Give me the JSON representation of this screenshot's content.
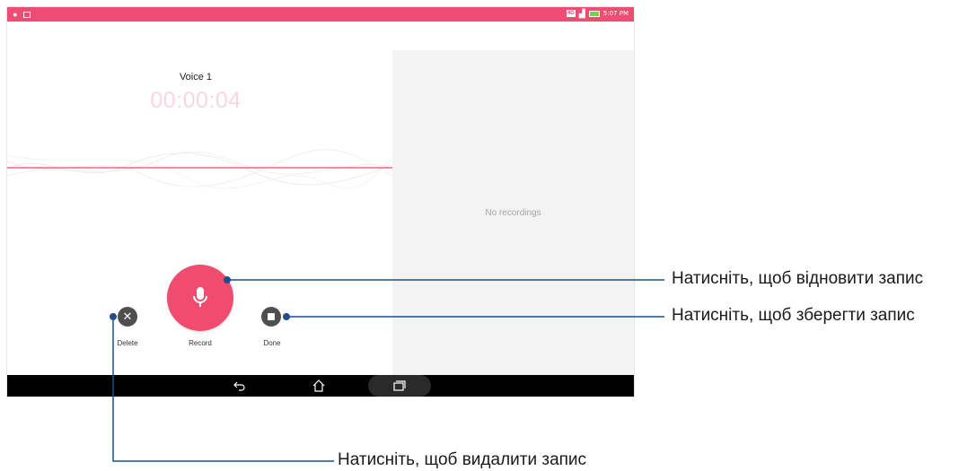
{
  "status_bar": {
    "time": "5:07 PM",
    "network": "4G",
    "left_icons": [
      "location-icon",
      "notification-icon"
    ],
    "right_icons": [
      "network-badge-icon",
      "signal-icon",
      "battery-charging-icon"
    ]
  },
  "recorder": {
    "title": "Voice 1",
    "timer": "00:00:04",
    "accent_color": "#ef4c70"
  },
  "controls": {
    "delete_label": "Delete",
    "record_label": "Record",
    "done_label": "Done"
  },
  "recordings_panel": {
    "empty_text": "No recordings"
  },
  "navigation": {
    "buttons": [
      "back-icon",
      "home-icon",
      "recent-apps-icon"
    ]
  },
  "callouts": {
    "resume": "Натисніть, щоб відновити запис",
    "save": "Натисніть, щоб зберегти запис",
    "delete": "Натисніть, щоб видалити запис"
  }
}
